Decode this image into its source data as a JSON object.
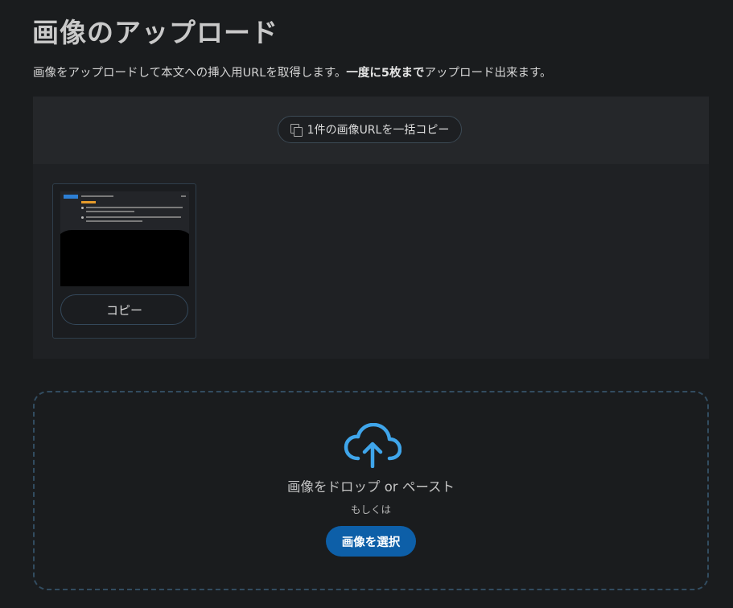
{
  "page": {
    "title": "画像のアップロード",
    "intro_prefix": "画像をアップロードして本文への挿入用URLを取得します。",
    "intro_bold": "一度に5枚まで",
    "intro_suffix": "アップロード出来ます。"
  },
  "gallery": {
    "copy_all_label": "1件の画像URLを一括コピー",
    "items": [
      {
        "copy_label": "コピー",
        "thumbnail_link_text": "qiitapipe.co"
      }
    ]
  },
  "dropzone": {
    "drop_text": "画像をドロップ or ペースト",
    "or_text": "もしくは",
    "select_button_label": "画像を選択"
  },
  "colors": {
    "background": "#1a1c1e",
    "accent": "#0d5fa8",
    "cloud_icon": "#3fa5ea"
  }
}
